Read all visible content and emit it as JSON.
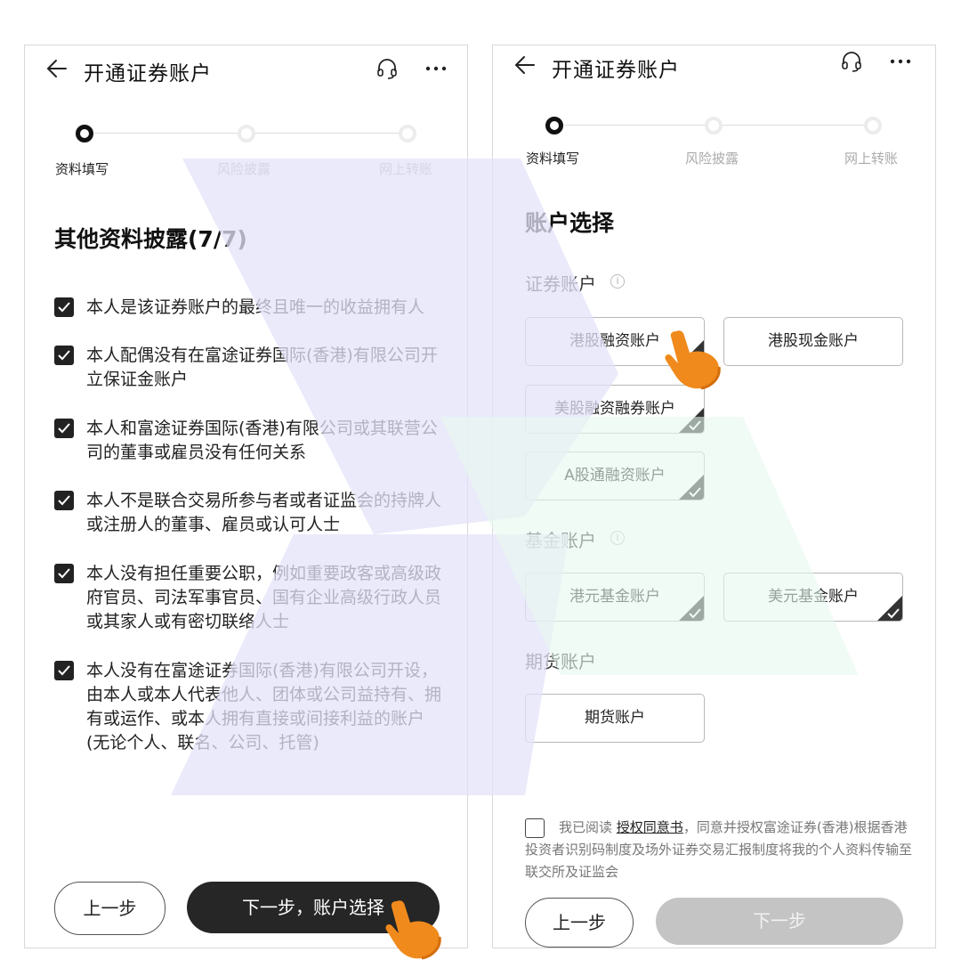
{
  "left": {
    "header": {
      "title": "开通证券账户"
    },
    "stepper": {
      "steps": [
        "资料填写",
        "风险披露",
        "网上转账"
      ]
    },
    "section_title": "其他资料披露(7/7)",
    "items": [
      "本人是该证券账户的最终且唯一的收益拥有人",
      "本人配偶没有在富途证券国际(香港)有限公司开立保证金账户",
      "本人和富途证券国际(香港)有限公司或其联营公司的董事或雇员没有任何关系",
      "本人不是联合交易所参与者或者证监会的持牌人或注册人的董事、雇员或认可人士",
      "本人没有担任重要公职，例如重要政客或高级政府官员、司法军事官员、国有企业高级行政人员或其家人或有密切联络人士",
      "本人没有在富途证券国际(香港)有限公司开设，由本人或本人代表他人、团体或公司益持有、拥有或运作、或本人拥有直接或间接利益的账户(无论个人、联名、公司、托管)"
    ],
    "prev_label": "上一步",
    "next_label": "下一步，账户选择"
  },
  "right": {
    "header": {
      "title": "开通证券账户"
    },
    "stepper": {
      "steps": [
        "资料填写",
        "风险披露",
        "网上转账"
      ]
    },
    "section_title": "账户选择",
    "securities": {
      "label": "证券账户",
      "accounts": [
        "港股融资账户",
        "港股现金账户",
        "美股融资融券账户",
        "A股通融资账户"
      ]
    },
    "funds": {
      "label": "基金账户",
      "accounts": [
        "港元基金账户",
        "美元基金账户"
      ]
    },
    "futures": {
      "label": "期货账户",
      "accounts": [
        "期货账户"
      ]
    },
    "agreement": {
      "prefix": "我已阅读",
      "link": "授权同意书",
      "suffix": "，同意并授权富途证券(香港)根据香港投资者识别码制度及场外证券交易汇报制度将我的个人资料传输至联交所及证监会"
    },
    "prev_label": "上一步",
    "next_label": "下一步"
  },
  "icons": [
    "back-arrow-icon",
    "headset-icon",
    "more-icon",
    "checkbox-checked-icon",
    "info-icon",
    "corner-check-icon",
    "hand-pointer-icon"
  ],
  "colors": {
    "dark": "#262626",
    "disabled": "#c4c4c4",
    "overlay_purple": "#e6e6fb",
    "overlay_green": "#e8f8ef",
    "hand": "#f08a1c"
  }
}
